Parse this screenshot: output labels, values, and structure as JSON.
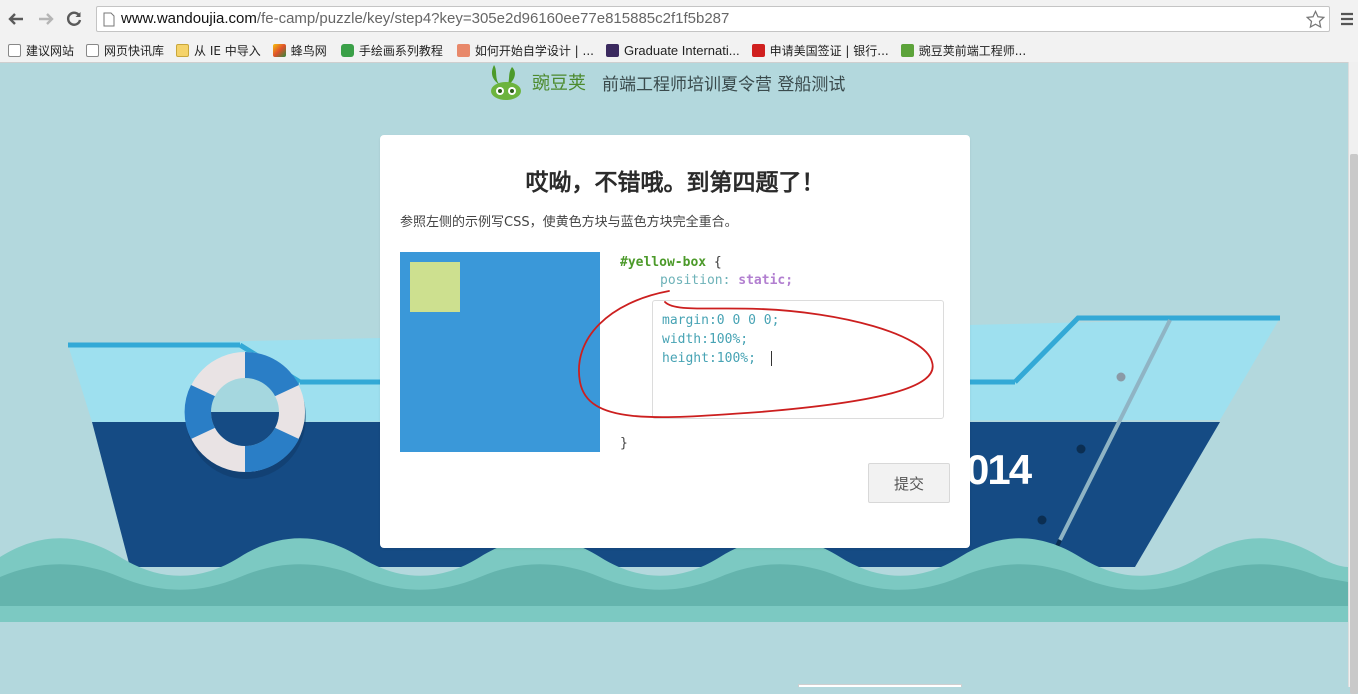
{
  "browser": {
    "back_icon": "arrow-left-icon",
    "forward_icon": "arrow-right-icon",
    "reload_icon": "reload-icon",
    "url_host": "www.wandoujia.com",
    "url_path": "/fe-camp/puzzle/key/step4?key=305e2d96160ee77e815885c2f1f5b287",
    "star_icon": "star-icon",
    "menu_icon": "hamburger-menu-icon",
    "bookmarks": [
      {
        "label": "建议网站",
        "icon": "page-icon",
        "color": "#ffffff"
      },
      {
        "label": "网页快讯库",
        "icon": "page-icon",
        "color": "#ffffff"
      },
      {
        "label": "从 IE 中导入",
        "icon": "folder-icon",
        "color": "#f5d36a"
      },
      {
        "label": "蜂鸟网",
        "icon": "fengniao-logo-icon",
        "color": "#e0512b"
      },
      {
        "label": "手绘画系列教程",
        "icon": "chat-bubble-icon",
        "color": "#3aa048"
      },
      {
        "label": "如何开始自学设计 | ...",
        "icon": "jian-logo-icon",
        "color": "#e8886a"
      },
      {
        "label": "Graduate Internati...",
        "icon": "onenote-icon",
        "color": "#3b2a5f"
      },
      {
        "label": "申请美国签证 | 银行...",
        "icon": "citi-logo-icon",
        "color": "#d0201f"
      },
      {
        "label": "豌豆荚前端工程师...",
        "icon": "wandoujia-logo-icon",
        "color": "#5ca33a"
      }
    ]
  },
  "header": {
    "brand": "豌豆荚",
    "title": "前端工程师培训夏令营 登船测试"
  },
  "puzzle": {
    "title": "哎呦，不错哦。到第四题了！",
    "instruction": "参照左侧的示例写CSS，使黄色方块与蓝色方块完全重合。",
    "selector": "#yellow-box",
    "open_brace": " {",
    "fixed_prop": "position: ",
    "fixed_value": "static;",
    "editor_lines": [
      "margin:0 0 0 0;",
      "width:100%;",
      "height:100%;"
    ],
    "close_brace": "}",
    "submit_label": "提交",
    "blue_color": "#3a98d9",
    "yellow_color": "#cde08f"
  },
  "ship": {
    "hull_text": "014"
  },
  "annotation": {
    "stroke_color": "#cc1f1f"
  }
}
